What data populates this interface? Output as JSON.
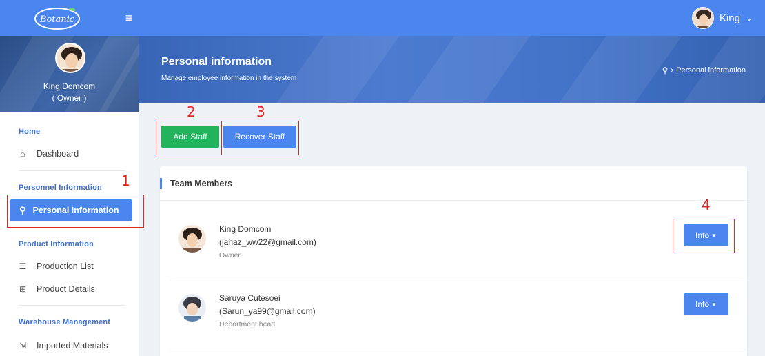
{
  "topbar": {
    "logo_text": "Botanic",
    "user_name": "King",
    "icons": {
      "menu": "hamburger-icon",
      "caret": "chevron-down-icon"
    }
  },
  "profile": {
    "name": "King Domcom",
    "role": "( Owner )"
  },
  "sidebar": {
    "sections": [
      {
        "title": "Home",
        "items": [
          {
            "label": "Dashboard",
            "icon": "home-icon"
          }
        ]
      },
      {
        "title": "Personnel Information",
        "items": [
          {
            "label": "Personal Information",
            "icon": "user-icon",
            "active": true
          }
        ]
      },
      {
        "title": "Product Information",
        "items": [
          {
            "label": "Production List",
            "icon": "list-icon"
          },
          {
            "label": "Product Details",
            "icon": "grid-icon"
          }
        ]
      },
      {
        "title": "Warehouse Management",
        "items": [
          {
            "label": "Imported Materials",
            "icon": "import-icon"
          }
        ]
      }
    ]
  },
  "header": {
    "title": "Personal information",
    "subtitle": "Manage employee information in the system",
    "breadcrumb": "Personal information",
    "breadcrumb_sep": "›"
  },
  "actions": {
    "add_label": "Add Staff",
    "recover_label": "Recover Staff"
  },
  "annotations": {
    "n1": "1",
    "n2": "2",
    "n3": "3",
    "n4": "4"
  },
  "team": {
    "title": "Team Members",
    "members": [
      {
        "name": "King Domcom",
        "email": "(jahaz_ww22@gmail.com)",
        "role": "Owner",
        "button": "Info"
      },
      {
        "name": "Saruya Cutesoei",
        "email": "(Sarun_ya99@gmail.com)",
        "role": "Department head",
        "button": "Info"
      }
    ]
  },
  "colors": {
    "primary": "#4a86ee",
    "success": "#22b35c",
    "annotation": "#e0261f",
    "section_title": "#3f6fd1"
  }
}
